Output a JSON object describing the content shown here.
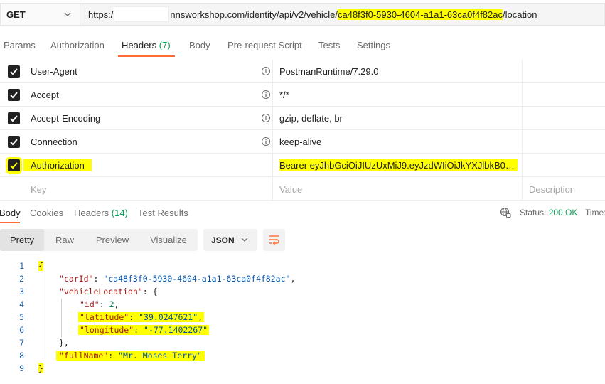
{
  "request": {
    "method": "GET",
    "url_prefix": "https:/",
    "url_domain_path": "nnsworkshop.com/identity/api/v2/vehicle/",
    "url_vehicle_id": "ca48f3f0-5930-4604-a1a1-63ca0f4f82ac",
    "url_suffix": "/location"
  },
  "request_tabs": [
    {
      "label": "Params"
    },
    {
      "label": "Authorization"
    },
    {
      "label": "Headers",
      "count": "(7)"
    },
    {
      "label": "Body"
    },
    {
      "label": "Pre-request Script"
    },
    {
      "label": "Tests"
    },
    {
      "label": "Settings"
    }
  ],
  "headers": [
    {
      "key": "User-Agent",
      "value": "PostmanRuntime/7.29.0",
      "checked": true
    },
    {
      "key": "Accept",
      "value": "*/*",
      "checked": true
    },
    {
      "key": "Accept-Encoding",
      "value": "gzip, deflate, br",
      "checked": true
    },
    {
      "key": "Connection",
      "value": "keep-alive",
      "checked": true
    },
    {
      "key": "Authorization",
      "value": "Bearer eyJhbGciOiJIUzUxMiJ9.eyJzdWIiOiJkYXJlbkB0ZX...",
      "checked": true
    }
  ],
  "headers_new_row": {
    "key_placeholder": "Key",
    "value_placeholder": "Value",
    "description_placeholder": "Description"
  },
  "response_tabs": [
    {
      "label": "Body"
    },
    {
      "label": "Cookies"
    },
    {
      "label": "Headers",
      "count": "(14)"
    },
    {
      "label": "Test Results"
    }
  ],
  "response_status": {
    "label": "Status:",
    "value": "200 OK",
    "time_label": "Time:"
  },
  "view_modes": [
    "Pretty",
    "Raw",
    "Preview",
    "Visualize"
  ],
  "format": "JSON",
  "code": {
    "line_numbers": [
      "1",
      "2",
      "3",
      "4",
      "5",
      "6",
      "7",
      "8",
      "9"
    ],
    "open_brace": "{",
    "close_brace": "}",
    "inner_open": "{",
    "inner_close": "},",
    "carId_key": "\"carId\"",
    "carId_val": "\"ca48f3f0-5930-4604-a1a1-63ca0f4f82ac\"",
    "vehicleLocation_key": "\"vehicleLocation\"",
    "id_key": "\"id\"",
    "id_val": "2",
    "latitude_key": "\"latitude\"",
    "latitude_val": "\"39.0247621\"",
    "longitude_key": "\"longitude\"",
    "longitude_val": "\"-77.1402267\"",
    "fullName_key": "\"fullName\"",
    "fullName_val": "\"Mr. Moses Terry\""
  },
  "colors": {
    "accent": "#ff6c37",
    "status_ok": "#0f9d58",
    "highlight": "#ffff00"
  }
}
